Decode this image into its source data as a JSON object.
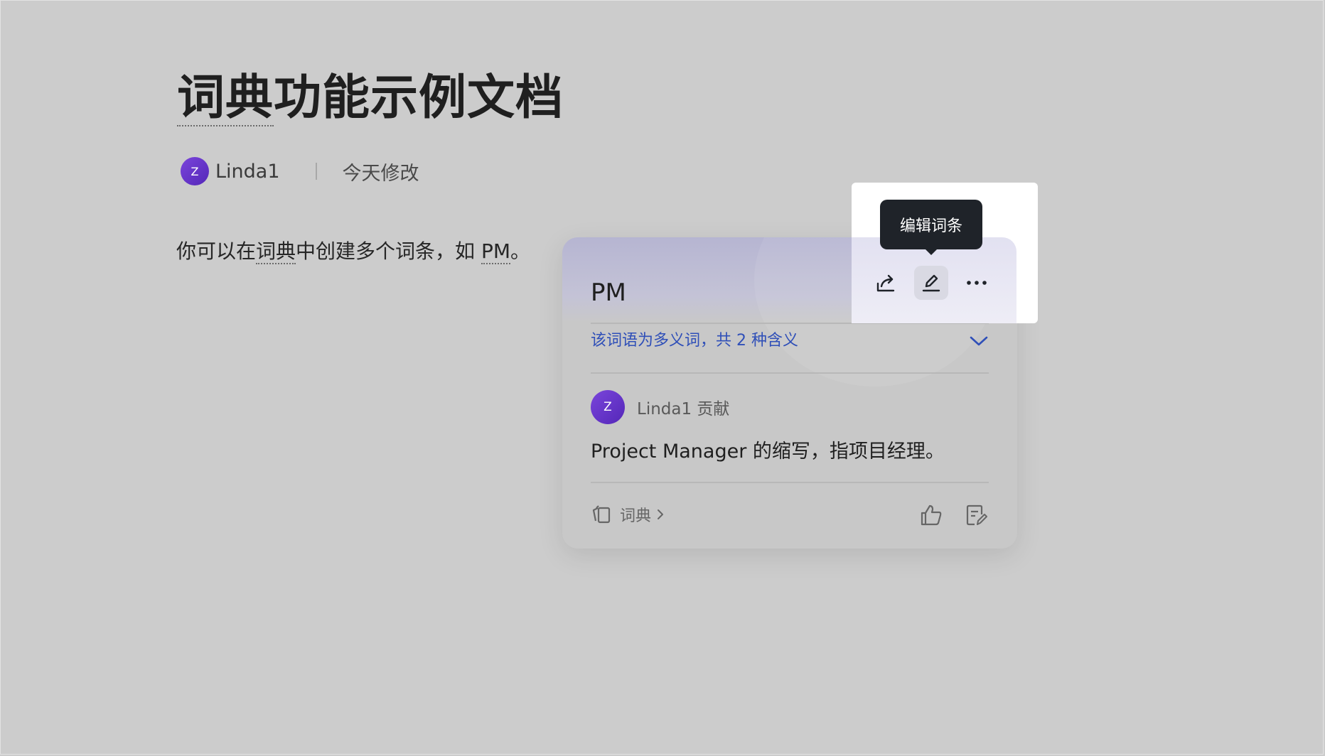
{
  "document": {
    "title_part1": "词典",
    "title_part2": "功能示例文档",
    "author_initial": "Z",
    "author": "Linda1",
    "modified": "今天修改",
    "body_part1": "你可以在",
    "body_link": "词典",
    "body_part2": "中创建多个词条，如 ",
    "body_term": "PM",
    "body_part3": "。"
  },
  "card": {
    "term": "PM",
    "polysemy_note": "该词语为多义词，共 2 种含义",
    "contributor_initial": "Z",
    "contributor": "Linda1 贡献",
    "definition": "Project Manager 的缩写，指项目经理。",
    "dictionary_link": "词典"
  },
  "tooltip": {
    "label": "编辑词条"
  },
  "icons": [
    "share-icon",
    "edit-icon",
    "more-icon",
    "chevron-down-icon",
    "dictionary-icon",
    "chevron-right-icon",
    "thumbs-up-icon",
    "note-icon"
  ],
  "colors": {
    "background": "#cccccc",
    "accent_link": "#2f4fb8",
    "avatar": "#6a35cc",
    "tooltip": "#1f2329"
  }
}
